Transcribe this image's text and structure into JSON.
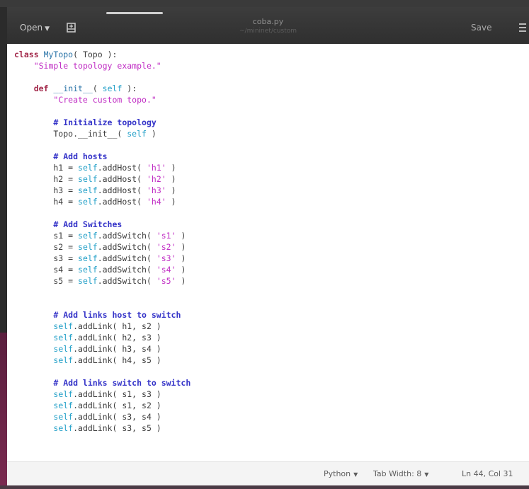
{
  "header": {
    "open_label": "Open",
    "title": "coba.py",
    "path": "~/mininet/custom",
    "save_label": "Save"
  },
  "status": {
    "language": "Python",
    "tab_width": "Tab Width: 8",
    "position": "Ln 44, Col 31"
  },
  "code_lines": [
    "class MyTopo( Topo ):",
    "    \"Simple topology example.\"",
    "",
    "    def __init__( self ):",
    "        \"Create custom topo.\"",
    "",
    "        # Initialize topology",
    "        Topo.__init__( self )",
    "",
    "        # Add hosts",
    "        h1 = self.addHost( 'h1' )",
    "        h2 = self.addHost( 'h2' )",
    "        h3 = self.addHost( 'h3' )",
    "        h4 = self.addHost( 'h4' )",
    "",
    "        # Add Switches",
    "        s1 = self.addSwitch( 's1' )",
    "        s2 = self.addSwitch( 's2' )",
    "        s3 = self.addSwitch( 's3' )",
    "        s4 = self.addSwitch( 's4' )",
    "        s5 = self.addSwitch( 's5' )",
    "",
    "",
    "        # Add links host to switch",
    "        self.addLink( h1, s2 )",
    "        self.addLink( h2, s3 )",
    "        self.addLink( h3, s4 )",
    "        self.addLink( h4, s5 )",
    "",
    "        # Add links switch to switch",
    "        self.addLink( s1, s3 )",
    "        self.addLink( s1, s2 )",
    "        self.addLink( s3, s4 )",
    "        self.addLink( s3, s5 )"
  ],
  "icons": {
    "open_caret": "chevron-down-icon",
    "new_document": "new-document-icon",
    "menu": "hamburger-menu-icon"
  },
  "colors": {
    "keyword": "#a2284a",
    "string": "#c02dc4",
    "comment": "#3433c8",
    "self": "#23a0c8",
    "class_name": "#2a74a8",
    "titlebar": "#353535"
  }
}
